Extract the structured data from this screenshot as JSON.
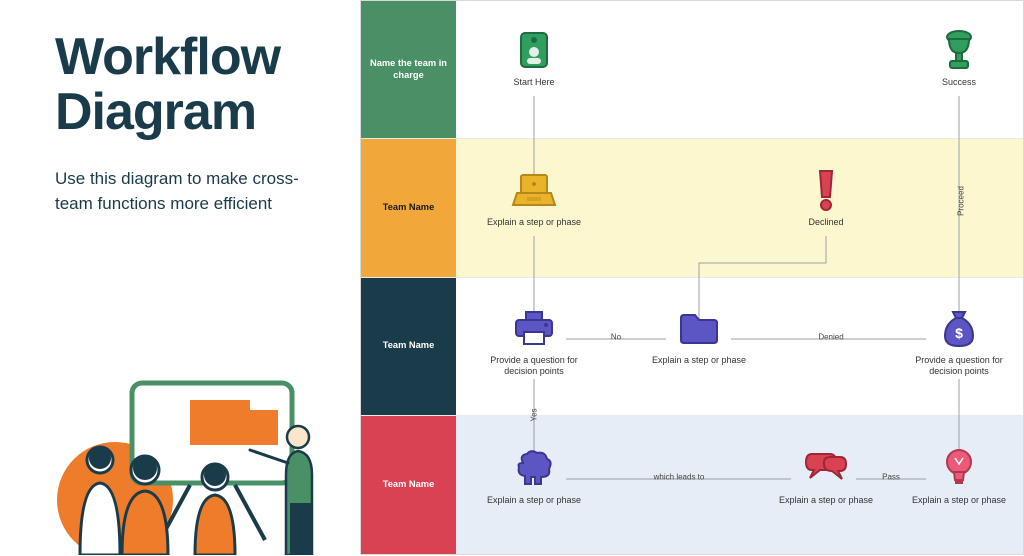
{
  "title_line1": "Workflow",
  "title_line2": "Diagram",
  "subtitle": "Use this diagram to make cross-team functions more efficient",
  "rows": [
    {
      "label": "Name the team in charge",
      "bg": "#4a9066",
      "text": "#ffffff",
      "content_bg": "#ffffff"
    },
    {
      "label": "Team Name",
      "bg": "#f2a73b",
      "text": "#1a1a1a",
      "content_bg": "#fdf7cf"
    },
    {
      "label": "Team Name",
      "bg": "#1a3b4a",
      "text": "#ffffff",
      "content_bg": "#ffffff"
    },
    {
      "label": "Team Name",
      "bg": "#d94253",
      "text": "#ffffff",
      "content_bg": "#e6edf7"
    }
  ],
  "nodes": {
    "r0_start": {
      "caption": "Start Here"
    },
    "r0_success": {
      "caption": "Success"
    },
    "r1_step": {
      "caption": "Explain a step or phase"
    },
    "r1_declined": {
      "caption": "Declined"
    },
    "r2_q1": {
      "caption": "Provide a question for decision points"
    },
    "r2_step": {
      "caption": "Explain a step or phase"
    },
    "r2_q2": {
      "caption": "Provide a question for decision points"
    },
    "r3_step1": {
      "caption": "Explain a step or phase"
    },
    "r3_step2": {
      "caption": "Explain a step or phase"
    },
    "r3_step3": {
      "caption": "Explain a step or phase"
    }
  },
  "connectors": {
    "no": "No",
    "yes": "Yes",
    "denied": "Denied",
    "proceed": "Proceed",
    "leadsto": "which leads to",
    "pass": "Pass"
  },
  "colors": {
    "green": "#2f9e5e",
    "yellow": "#e9b32a",
    "orange": "#ef7c2a",
    "navy": "#1a3b4a",
    "purple": "#5c55c4",
    "red": "#d94253",
    "redDeep": "#c23a49",
    "pink": "#e0506a"
  }
}
